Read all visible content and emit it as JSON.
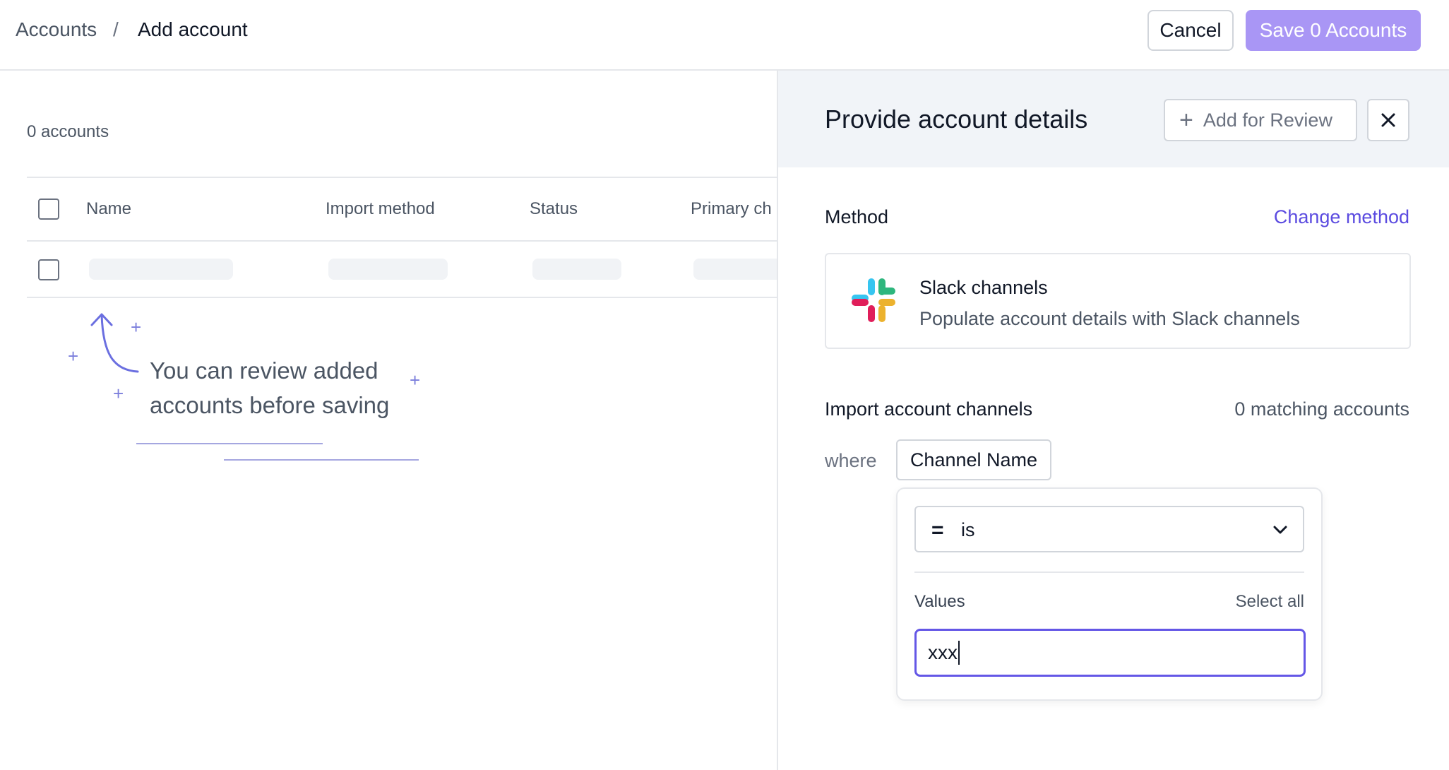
{
  "breadcrumb": {
    "root": "Accounts",
    "separator": "/",
    "current": "Add account"
  },
  "header": {
    "cancel_label": "Cancel",
    "save_label": "Save 0 Accounts"
  },
  "list": {
    "count_text": "0 accounts",
    "columns": [
      "Name",
      "Import method",
      "Status",
      "Primary ch"
    ]
  },
  "hint": {
    "line1": "You can review added",
    "line2": "accounts before saving"
  },
  "panel": {
    "title": "Provide account details",
    "add_review_label": "Add for Review",
    "method_label": "Method",
    "change_method_label": "Change method",
    "method_card": {
      "title": "Slack channels",
      "subtitle": "Populate account details with Slack channels",
      "icon": "slack-logo"
    },
    "import_label": "Import account channels",
    "matching_text": "0 matching accounts",
    "where_label": "where",
    "field_chip": "Channel Name",
    "filter": {
      "operator_symbol": "=",
      "operator_label": "is",
      "values_label": "Values",
      "select_all_label": "Select all",
      "values_input": "xxx"
    }
  },
  "colors": {
    "accent": "#5b4be0",
    "save_button": "#a996f5",
    "panel_header": "#f1f4f8"
  }
}
